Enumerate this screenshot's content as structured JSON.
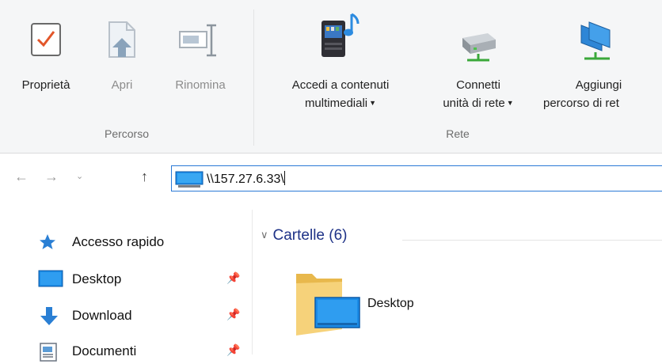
{
  "ribbon": {
    "buttons": [
      {
        "label": "Proprietà"
      },
      {
        "label": "Apri"
      },
      {
        "label": "Rinomina"
      },
      {
        "label_line1": "Accedi a contenuti",
        "label_line2": "multimediali"
      },
      {
        "label_line1": "Connetti",
        "label_line2": "unità di rete"
      },
      {
        "label_line1": "Aggiungi",
        "label_line2": "percorso di ret"
      }
    ],
    "groups": [
      "Percorso",
      "Rete"
    ]
  },
  "address": {
    "value": "\\\\157.27.6.33\\"
  },
  "sidebar": {
    "items": [
      {
        "label": "Accesso rapido",
        "icon": "star-icon"
      },
      {
        "label": "Desktop",
        "icon": "desktop-icon"
      },
      {
        "label": "Download",
        "icon": "download-arrow-icon"
      },
      {
        "label": "Documenti",
        "icon": "documents-icon"
      }
    ]
  },
  "content": {
    "section_title": "Cartelle (6)",
    "folders": [
      {
        "label": "Desktop"
      }
    ]
  },
  "colors": {
    "accent": "#2b7ad6",
    "section_title": "#1e3287",
    "ribbon_bg": "#f5f6f7"
  }
}
